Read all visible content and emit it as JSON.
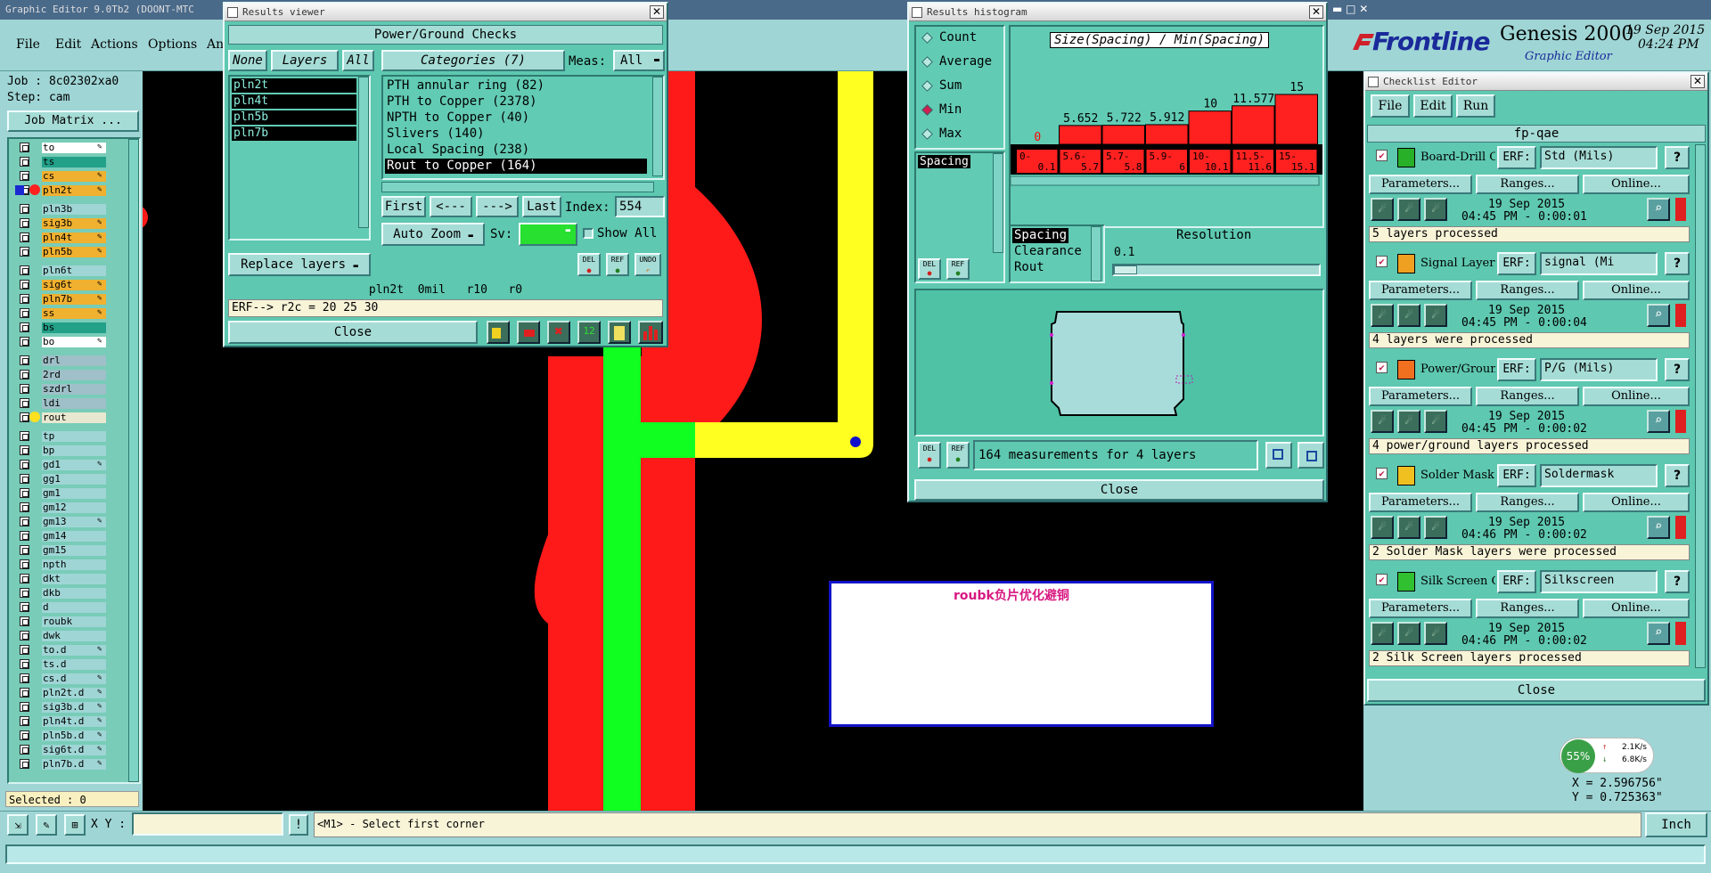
{
  "main": {
    "title": "Graphic Editor 9.0Tb2 (DOONT-MTC",
    "menu": [
      "File",
      "Edit",
      "Actions",
      "Options",
      "An"
    ],
    "job": "Job : 8c02302xa0",
    "step": "Step: cam",
    "job_matrix": "Job Matrix ...",
    "layers": [
      {
        "name": "to",
        "color": "#ffffff",
        "edit": true
      },
      {
        "name": "ts",
        "color": "#22a088",
        "edit": false
      },
      {
        "name": "cs",
        "color": "#f0b030",
        "edit": true
      },
      {
        "name": "pln2t",
        "color": "#f0b030",
        "edit": true,
        "active": true
      },
      {
        "name": "pln3b",
        "color": "#9fd5d5",
        "edit": false
      },
      {
        "name": "sig3b",
        "color": "#f0b030",
        "edit": true
      },
      {
        "name": "pln4t",
        "color": "#f0b030",
        "edit": true
      },
      {
        "name": "pln5b",
        "color": "#f0b030",
        "edit": true
      },
      {
        "name": "pln6t",
        "color": "#9fd5d5",
        "edit": false
      },
      {
        "name": "sig6t",
        "color": "#f0b030",
        "edit": true
      },
      {
        "name": "pln7b",
        "color": "#f0b030",
        "edit": true
      },
      {
        "name": "ss",
        "color": "#f0b030",
        "edit": true
      },
      {
        "name": "bs",
        "color": "#22a088",
        "edit": false
      },
      {
        "name": "bo",
        "color": "#ffffff",
        "edit": true
      },
      {
        "name": "drl",
        "color": "#9fc0c8",
        "edit": false
      },
      {
        "name": "2rd",
        "color": "#9fc0c8",
        "edit": false
      },
      {
        "name": "szdrl",
        "color": "#9fc0c8",
        "edit": false
      },
      {
        "name": "ldi",
        "color": "#9fc0c8",
        "edit": false
      },
      {
        "name": "rout",
        "color": "#e8e8d0",
        "edit": false,
        "dot": true
      },
      {
        "name": "tp",
        "color": "#9fd5d5",
        "edit": false
      },
      {
        "name": "bp",
        "color": "#9fd5d5",
        "edit": false
      },
      {
        "name": "gd1",
        "color": "#9fd5d5",
        "edit": true
      },
      {
        "name": "gg1",
        "color": "#9fd5d5",
        "edit": false
      },
      {
        "name": "gm1",
        "color": "#9fd5d5",
        "edit": false
      },
      {
        "name": "gm12",
        "color": "#9fd5d5",
        "edit": false
      },
      {
        "name": "gm13",
        "color": "#9fd5d5",
        "edit": true
      },
      {
        "name": "gm14",
        "color": "#9fd5d5",
        "edit": false
      },
      {
        "name": "gm15",
        "color": "#9fd5d5",
        "edit": false
      },
      {
        "name": "npth",
        "color": "#9fd5d5",
        "edit": false
      },
      {
        "name": "dkt",
        "color": "#9fd5d5",
        "edit": false
      },
      {
        "name": "dkb",
        "color": "#9fd5d5",
        "edit": false
      },
      {
        "name": "d",
        "color": "#9fd5d5",
        "edit": false
      },
      {
        "name": "roubk",
        "color": "#9fd5d5",
        "edit": false
      },
      {
        "name": "dwk",
        "color": "#9fd5d5",
        "edit": false
      },
      {
        "name": "to.d",
        "color": "#9fd5d5",
        "edit": true
      },
      {
        "name": "ts.d",
        "color": "#9fd5d5",
        "edit": false
      },
      {
        "name": "cs.d",
        "color": "#9fd5d5",
        "edit": true
      },
      {
        "name": "pln2t.d",
        "color": "#9fd5d5",
        "edit": true
      },
      {
        "name": "sig3b.d",
        "color": "#9fd5d5",
        "edit": true
      },
      {
        "name": "pln4t.d",
        "color": "#9fd5d5",
        "edit": true
      },
      {
        "name": "pln5b.d",
        "color": "#9fd5d5",
        "edit": true
      },
      {
        "name": "sig6t.d",
        "color": "#9fd5d5",
        "edit": true
      },
      {
        "name": "pln7b.d",
        "color": "#9fd5d5",
        "edit": true
      }
    ],
    "selected": "Selected : 0",
    "xy_label": "X Y :",
    "xy_value": "",
    "prompt": "<M1> - Select first corner",
    "units": "Inch",
    "x_coord": "X = 2.596756\"",
    "y_coord": "Y = 0.725363\"",
    "canvas_note": "roubk负片优化避铜"
  },
  "brand": {
    "logo": "Frontline",
    "product": "Genesis 2000",
    "subtitle": "Graphic Editor",
    "date": "19 Sep 2015",
    "time": "04:24 PM"
  },
  "results_viewer": {
    "title": "Results viewer",
    "heading": "Power/Ground Checks",
    "btn_none": "None",
    "btn_layers": "Layers",
    "btn_all": "All",
    "categories_label": "Categories (7)",
    "meas_label": "Meas:",
    "meas_value": "All",
    "layers": [
      "pln2t",
      "pln4t",
      "pln5b",
      "pln7b"
    ],
    "categories": [
      "PTH annular ring (82)",
      "PTH to Copper (2378)",
      "NPTH to Copper (40)",
      "Slivers (140)",
      "Local Spacing (238)",
      "Rout to Copper (164)"
    ],
    "selected_category": 5,
    "nav_first": "First",
    "nav_prev": "<---",
    "nav_next": "--->",
    "nav_last": "Last",
    "index_label": "Index:",
    "index_value": "554",
    "auto_zoom": "Auto Zoom",
    "sv_label": "Sv:",
    "show_all": "Show All",
    "replace_layers": "Replace layers",
    "icon_del": "DEL",
    "icon_ref": "REF",
    "icon_undo": "UNDO",
    "info": "pln2t  0mil   r10   r0",
    "erf": "ERF--> r2c = 20 25 30",
    "close": "Close"
  },
  "histogram": {
    "title": "Results histogram",
    "options": [
      "Count",
      "Average",
      "Sum",
      "Min",
      "Max"
    ],
    "selected_option": 3,
    "list_selected": "Spacing",
    "chart_title": "Size(Spacing) / Min(Spacing)",
    "meas_list": [
      "Spacing",
      "Clearance",
      "Rout"
    ],
    "resolution_label": "Resolution",
    "resolution_value": "0.1",
    "summary": "164 measurements for 4 layers",
    "close": "Close",
    "icon_del": "DEL",
    "icon_ref": "REF"
  },
  "chart_data": {
    "type": "bar",
    "title": "Size(Spacing) / Min(Spacing)",
    "categories": [
      "0-\n0.1",
      "5.6-\n5.7",
      "5.7-\n5.8",
      "5.9-\n6",
      "10-\n10.1",
      "11.5-\n11.6",
      "15-\n15.1"
    ],
    "values": [
      0,
      5.652,
      5.722,
      5.912,
      10,
      11.577,
      15
    ],
    "labels": [
      "0",
      "5.652",
      "5.722",
      "5.912",
      "10",
      "11.577",
      "15"
    ],
    "ylim": [
      0,
      15
    ],
    "bar_color": "#ff2020",
    "zero_label_color": "#ff0000"
  },
  "checklist": {
    "title": "Checklist Editor",
    "menu": [
      "File",
      "Edit",
      "Run"
    ],
    "name": "fp-qae",
    "items": [
      {
        "name": "Board-Drill Che",
        "erf_label": "ERF:",
        "erf": "Std (Mils)",
        "date": "19 Sep 2015",
        "time": "04:45 PM - 0:00:01",
        "status": "5 layers processed"
      },
      {
        "name": "Signal Layer Ch",
        "erf_label": "ERF:",
        "erf": "signal (Mi",
        "date": "19 Sep 2015",
        "time": "04:45 PM - 0:00:04",
        "status": "4 layers were processed"
      },
      {
        "name": "Power/Ground C",
        "erf_label": "ERF:",
        "erf": "P/G (Mils)",
        "date": "19 Sep 2015",
        "time": "04:45 PM - 0:00:02",
        "status": "4 power/ground layers processed"
      },
      {
        "name": "Solder Mask Che",
        "erf_label": "ERF:",
        "erf": "Soldermask",
        "date": "19 Sep 2015",
        "time": "04:46 PM - 0:00:02",
        "status": "2 Solder Mask layers were processed"
      },
      {
        "name": "Silk Screen Che",
        "erf_label": "ERF:",
        "erf": "Silkscreen",
        "date": "19 Sep 2015",
        "time": "04:46 PM - 0:00:02",
        "status": "2 Silk Screen layers processed"
      }
    ],
    "params": "Parameters...",
    "ranges": "Ranges...",
    "online": "Online...",
    "help": "?",
    "close": "Close"
  },
  "net_widget": {
    "percent": "55%",
    "up": "2.1K/s",
    "down": "6.8K/s"
  }
}
